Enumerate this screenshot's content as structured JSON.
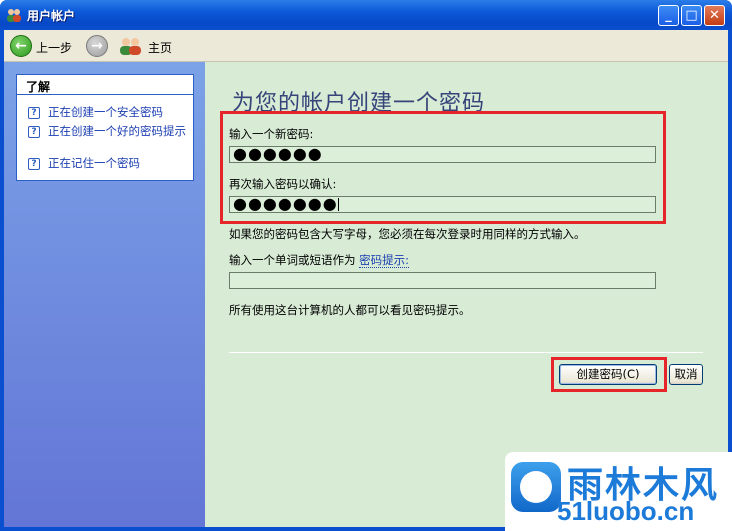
{
  "window": {
    "title": "用户帐户"
  },
  "toolbar": {
    "back_label": "上一步",
    "home_label": "主页"
  },
  "sidebar": {
    "section_title": "了解",
    "items": [
      {
        "label": "正在创建一个安全密码"
      },
      {
        "label": "正在创建一个好的密码提示"
      },
      {
        "label": "正在记住一个密码"
      }
    ]
  },
  "main": {
    "heading": "为您的帐户创建一个密码",
    "new_password_label": "输入一个新密码:",
    "new_password_value": "●●●●●●",
    "confirm_label": "再次输入密码以确认:",
    "confirm_value": "●●●●●●●",
    "case_note": "如果您的密码包含大写字母，您必须在每次登录时用同样的方式输入。",
    "hint_label": "输入一个单词或短语作为",
    "hint_link": "密码提示:",
    "hint_value": "",
    "hint_note": "所有使用这台计算机的人都可以看见密码提示。",
    "create_button": "创建密码(C)",
    "cancel_button": "取消"
  },
  "watermark": {
    "brand": "雨林木风",
    "domain": "51luobo.cn"
  },
  "colors": {
    "titlebar": "#0b58d8",
    "sidebar": "#7ba2e7",
    "content_bg": "#d7ebd5",
    "highlight_box": "#e5252a",
    "link": "#1c3fb1"
  }
}
